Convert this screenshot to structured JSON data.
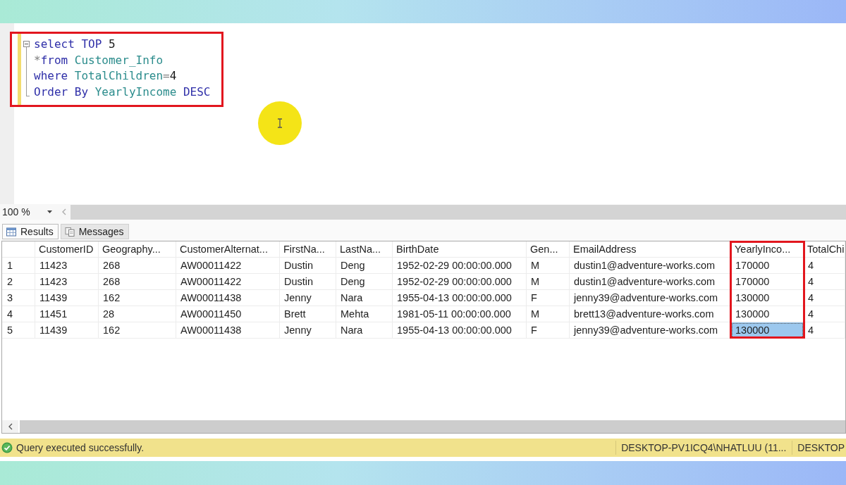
{
  "editor": {
    "unsaved_changes": true,
    "fold_expanded": true,
    "highlighted": true,
    "lines": [
      {
        "words": [
          [
            {
              "text": "select",
              "kind": "keyword"
            }
          ],
          [
            {
              "text": "TOP",
              "kind": "keyword"
            }
          ],
          [
            {
              "text": "5",
              "kind": "literal"
            }
          ]
        ]
      },
      {
        "words": [
          [
            {
              "text": "*",
              "kind": "operator"
            },
            {
              "text": "from",
              "kind": "keyword"
            }
          ],
          [
            {
              "text": "Customer_Info",
              "kind": "identifier"
            }
          ]
        ]
      },
      {
        "words": [
          [
            {
              "text": "where",
              "kind": "keyword"
            }
          ],
          [
            {
              "text": "TotalChildren",
              "kind": "identifier"
            },
            {
              "text": "=",
              "kind": "operator"
            },
            {
              "text": "4",
              "kind": "literal"
            }
          ]
        ]
      },
      {
        "words": [
          [
            {
              "text": "Order",
              "kind": "keyword"
            }
          ],
          [
            {
              "text": "By",
              "kind": "keyword"
            }
          ],
          [
            {
              "text": "YearlyIncome",
              "kind": "identifier"
            }
          ],
          [
            {
              "text": "DESC",
              "kind": "keyword"
            }
          ]
        ]
      }
    ]
  },
  "zoom": {
    "value": "100 %"
  },
  "result_tabs": [
    {
      "label": "Results",
      "kind": "results",
      "selected": true
    },
    {
      "label": "Messages",
      "kind": "messages",
      "selected": false
    }
  ],
  "grid": {
    "columns": [
      {
        "label": "CustomerID",
        "highlighted": false
      },
      {
        "label": "Geography...",
        "highlighted": false
      },
      {
        "label": "CustomerAlternat...",
        "highlighted": false
      },
      {
        "label": "FirstNa...",
        "highlighted": false
      },
      {
        "label": "LastNa...",
        "highlighted": false
      },
      {
        "label": "BirthDate",
        "highlighted": false
      },
      {
        "label": "Gen...",
        "highlighted": false
      },
      {
        "label": "EmailAddress",
        "highlighted": false
      },
      {
        "label": "YearlyInco...",
        "highlighted": true
      },
      {
        "label": "TotalChi",
        "highlighted": false
      }
    ],
    "rows": [
      {
        "number": "1",
        "cells": [
          {
            "text": "11423",
            "selected": false
          },
          {
            "text": "268",
            "selected": false
          },
          {
            "text": "AW00011422",
            "selected": false
          },
          {
            "text": "Dustin",
            "selected": false
          },
          {
            "text": "Deng",
            "selected": false
          },
          {
            "text": "1952-02-29 00:00:00.000",
            "selected": false
          },
          {
            "text": "M",
            "selected": false
          },
          {
            "text": "dustin1@adventure-works.com",
            "selected": false
          },
          {
            "text": "170000",
            "selected": false
          },
          {
            "text": "4",
            "selected": false
          }
        ]
      },
      {
        "number": "2",
        "cells": [
          {
            "text": "11423",
            "selected": false
          },
          {
            "text": "268",
            "selected": false
          },
          {
            "text": "AW00011422",
            "selected": false
          },
          {
            "text": "Dustin",
            "selected": false
          },
          {
            "text": "Deng",
            "selected": false
          },
          {
            "text": "1952-02-29 00:00:00.000",
            "selected": false
          },
          {
            "text": "M",
            "selected": false
          },
          {
            "text": "dustin1@adventure-works.com",
            "selected": false
          },
          {
            "text": "170000",
            "selected": false
          },
          {
            "text": "4",
            "selected": false
          }
        ]
      },
      {
        "number": "3",
        "cells": [
          {
            "text": "11439",
            "selected": false
          },
          {
            "text": "162",
            "selected": false
          },
          {
            "text": "AW00011438",
            "selected": false
          },
          {
            "text": "Jenny",
            "selected": false
          },
          {
            "text": "Nara",
            "selected": false
          },
          {
            "text": "1955-04-13 00:00:00.000",
            "selected": false
          },
          {
            "text": "F",
            "selected": false
          },
          {
            "text": "jenny39@adventure-works.com",
            "selected": false
          },
          {
            "text": "130000",
            "selected": false
          },
          {
            "text": "4",
            "selected": false
          }
        ]
      },
      {
        "number": "4",
        "cells": [
          {
            "text": "11451",
            "selected": false
          },
          {
            "text": "28",
            "selected": false
          },
          {
            "text": "AW00011450",
            "selected": false
          },
          {
            "text": "Brett",
            "selected": false
          },
          {
            "text": "Mehta",
            "selected": false
          },
          {
            "text": "1981-05-11 00:00:00.000",
            "selected": false
          },
          {
            "text": "M",
            "selected": false
          },
          {
            "text": "brett13@adventure-works.com",
            "selected": false
          },
          {
            "text": "130000",
            "selected": false
          },
          {
            "text": "4",
            "selected": false
          }
        ]
      },
      {
        "number": "5",
        "cells": [
          {
            "text": "11439",
            "selected": false
          },
          {
            "text": "162",
            "selected": false
          },
          {
            "text": "AW00011438",
            "selected": false
          },
          {
            "text": "Jenny",
            "selected": false
          },
          {
            "text": "Nara",
            "selected": false
          },
          {
            "text": "1955-04-13 00:00:00.000",
            "selected": false
          },
          {
            "text": "F",
            "selected": false
          },
          {
            "text": "jenny39@adventure-works.com",
            "selected": false
          },
          {
            "text": "130000",
            "selected": true
          },
          {
            "text": "4",
            "selected": false
          }
        ]
      }
    ]
  },
  "status_bar": {
    "succeeded": true,
    "message": "Query executed successfully.",
    "sections": [
      "DESKTOP-PV1ICQ4\\NHATLUU (11...",
      "DESKTOP"
    ]
  }
}
